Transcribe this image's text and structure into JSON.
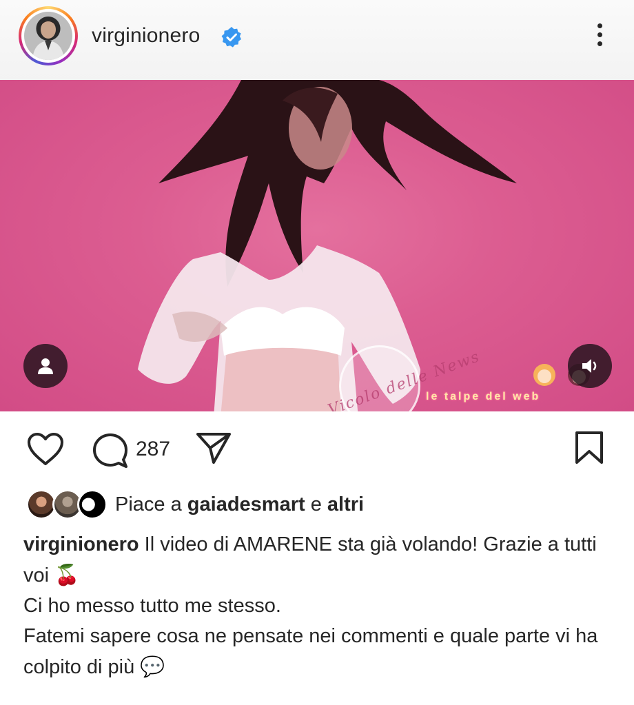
{
  "header": {
    "username": "virginionero",
    "verified_icon": "verified-badge-icon",
    "more_icon": "more-vertical-icon"
  },
  "media": {
    "watermark_1": "Vicolo delle News",
    "watermark_2": "le talpe del web",
    "user_button_icon": "user-tag-icon",
    "sound_button_icon": "speaker-icon"
  },
  "actions": {
    "like_icon": "heart-icon",
    "comment_icon": "comment-bubble-icon",
    "comment_count": "287",
    "share_icon": "send-icon",
    "save_icon": "bookmark-icon"
  },
  "likes": {
    "prefix": "Piace a",
    "user": "gaiadesmart",
    "conjunction": "e",
    "others": "altri"
  },
  "caption": {
    "username": "virginionero",
    "line1": "Il video di AMARENE sta già volando! Grazie a tutti voi",
    "line1_emoji": "🍒",
    "line2": "Ci ho messo tutto me stesso.",
    "line3": "Fatemi sapere cosa ne pensate nei commenti e quale parte vi ha colpito di più",
    "line3_emoji": "💬"
  },
  "colors": {
    "accent_blue": "#3897f0",
    "media_pink": "#dc5d91",
    "text": "#262626"
  }
}
